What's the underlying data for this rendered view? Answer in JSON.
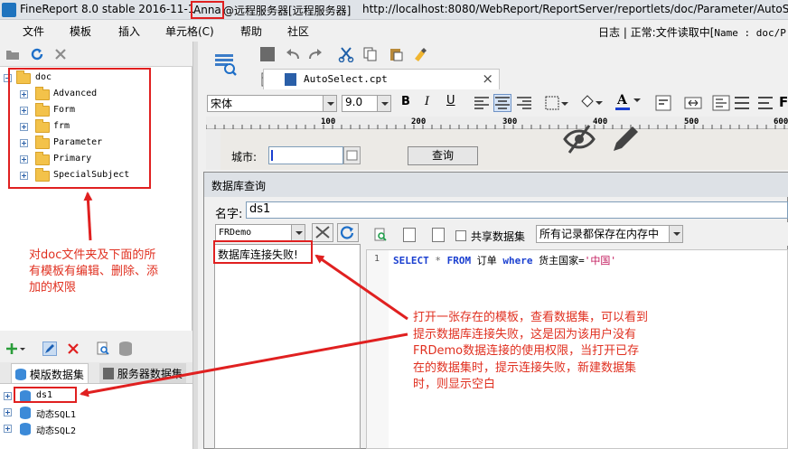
{
  "window": {
    "title_prefix": "FineReport 8.0 stable 2016-11-1",
    "title_user": "Anna",
    "title_server": "@远程服务器[远程服务器]",
    "title_url": "http://localhost:8080/WebReport/ReportServer/reportlets/doc/Parameter/AutoSe"
  },
  "menu": {
    "items": [
      "文件",
      "模板",
      "插入",
      "单元格(C)",
      "帮助",
      "社区"
    ],
    "status_prefix": "日志 | 正常:文件读取中[",
    "status_path": "Name : doc/P"
  },
  "tree": {
    "root": "doc",
    "folders": [
      "Advanced",
      "Form",
      "frm",
      "Parameter",
      "Primary",
      "SpecialSubject"
    ]
  },
  "annotations": {
    "tree_note": "对doc文件夹及下面的所有模板有编辑、删除、添加的权限",
    "sql_note": "打开一张存在的模板，查看数据集，可以看到提示数据库连接失败，这是因为该用户没有FRDemo数据连接的使用权限，当打开已存在的数据集时，提示连接失败，新建数据集时，则显示空白"
  },
  "dataset_panel": {
    "tabs": [
      "模版数据集",
      "服务器数据集"
    ],
    "items": [
      "ds1",
      "动态SQL1",
      "动态SQL2"
    ]
  },
  "editor": {
    "file_tab": "AutoSelect.cpt",
    "font_name": "宋体",
    "font_size": "9.0",
    "ruler_labels": [
      "100",
      "200",
      "300",
      "400",
      "500",
      "600"
    ],
    "param_label": "城市:",
    "query_button": "查询"
  },
  "dialog": {
    "title": "数据库查询",
    "name_label": "名字:",
    "name_value": "ds1",
    "connection": "FRDemo",
    "connection_error": "数据库连接失败!",
    "share_label": "共享数据集",
    "cache_option": "所有记录都保存在内存中",
    "line_number": "1",
    "sql": {
      "kw1": "SELECT",
      "star": "*",
      "kw2": "FROM",
      "table": "订单",
      "kw3": "where",
      "cond": "货主国家=",
      "str": "'中国'"
    }
  }
}
